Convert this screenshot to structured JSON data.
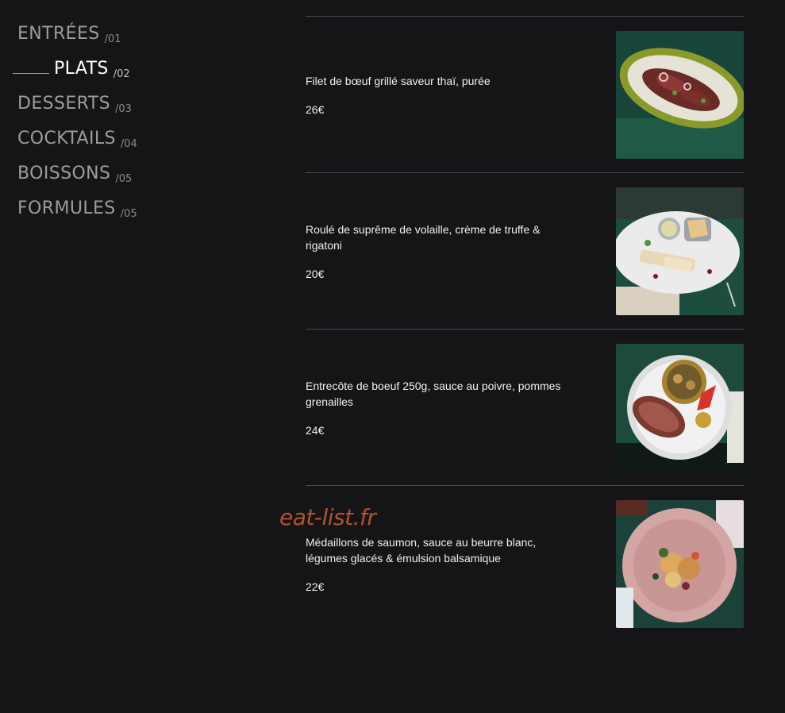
{
  "categories": [
    {
      "label": "ENTRÉES",
      "num": "/01"
    },
    {
      "label": "PLATS",
      "num": "/02"
    },
    {
      "label": "DESSERTS",
      "num": "/03"
    },
    {
      "label": "COCKTAILS",
      "num": "/04"
    },
    {
      "label": "BOISSONS",
      "num": "/05"
    },
    {
      "label": "FORMULES",
      "num": "/05"
    }
  ],
  "active_category": "PLATS",
  "items": [
    {
      "name": "Filet de bœuf grillé saveur thaï, purée",
      "price": "26€",
      "image": "beef-fillet-plate-photo"
    },
    {
      "name": "Roulé de suprême de volaille, crème de truffe & rigatoni",
      "price": "20€",
      "image": "chicken-roll-plate-photo"
    },
    {
      "name": "Entrecôte de boeuf 250g, sauce au poivre, pommes grenailles",
      "price": "24€",
      "image": "entrecote-plate-photo"
    },
    {
      "name": "Médaillons de saumon, sauce au beurre blanc, légumes glacés & émulsion balsamique",
      "price": "22€",
      "image": "salmon-medallions-plate-photo"
    }
  ],
  "watermark": "eat-list.fr",
  "colors": {
    "background": "#151518",
    "text": "#f0f0f0",
    "muted": "#9c9c9e",
    "watermark": "#b5512c",
    "divider": "#4a4a4e"
  }
}
